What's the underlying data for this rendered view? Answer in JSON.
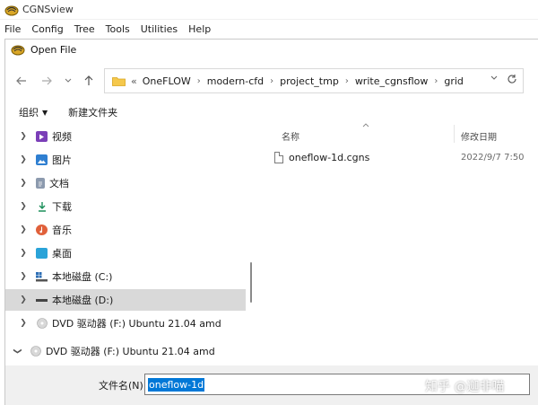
{
  "app": {
    "title": "CGNSview",
    "menu": [
      "File",
      "Config",
      "Tree",
      "Tools",
      "Utilities",
      "Help"
    ]
  },
  "dialog": {
    "title": "Open File",
    "breadcrumb_lead": "«",
    "breadcrumb": [
      "OneFLOW",
      "modern-cfd",
      "project_tmp",
      "write_cgnsflow",
      "grid"
    ],
    "toolbar": {
      "organize": "组织",
      "new_folder": "新建文件夹"
    },
    "tree": [
      {
        "label": "视频",
        "icon": "video-icon",
        "color": "#7b3fb8"
      },
      {
        "label": "图片",
        "icon": "pictures-icon",
        "color": "#2f7fd1"
      },
      {
        "label": "文档",
        "icon": "documents-icon",
        "color": "#6b7a8f"
      },
      {
        "label": "下载",
        "icon": "download-icon",
        "color": "#1b8f5a"
      },
      {
        "label": "音乐",
        "icon": "music-icon",
        "color": "#e0603a"
      },
      {
        "label": "桌面",
        "icon": "desktop-icon",
        "color": "#2aa3d8"
      },
      {
        "label": "本地磁盘 (C:)",
        "icon": "windows-drive-icon",
        "color": "#2f6fb5"
      },
      {
        "label": "本地磁盘 (D:)",
        "icon": "drive-icon",
        "color": "#444444"
      },
      {
        "label": "DVD 驱动器 (F:) Ubuntu 21.04 amd",
        "icon": "dvd-icon",
        "color": "#b5b5b5"
      }
    ],
    "tree_bottom": {
      "label": "DVD 驱动器 (F:) Ubuntu 21.04 amd",
      "icon": "dvd-icon"
    },
    "columns": {
      "name": "名称",
      "modified": "修改日期"
    },
    "files": [
      {
        "name": "oneflow-1d.cgns",
        "modified": "2022/9/7 7:50"
      }
    ],
    "filename_label": "文件名(N):",
    "filename_value": "oneflow-1d",
    "watermark": "知乎 @迦非喵"
  }
}
